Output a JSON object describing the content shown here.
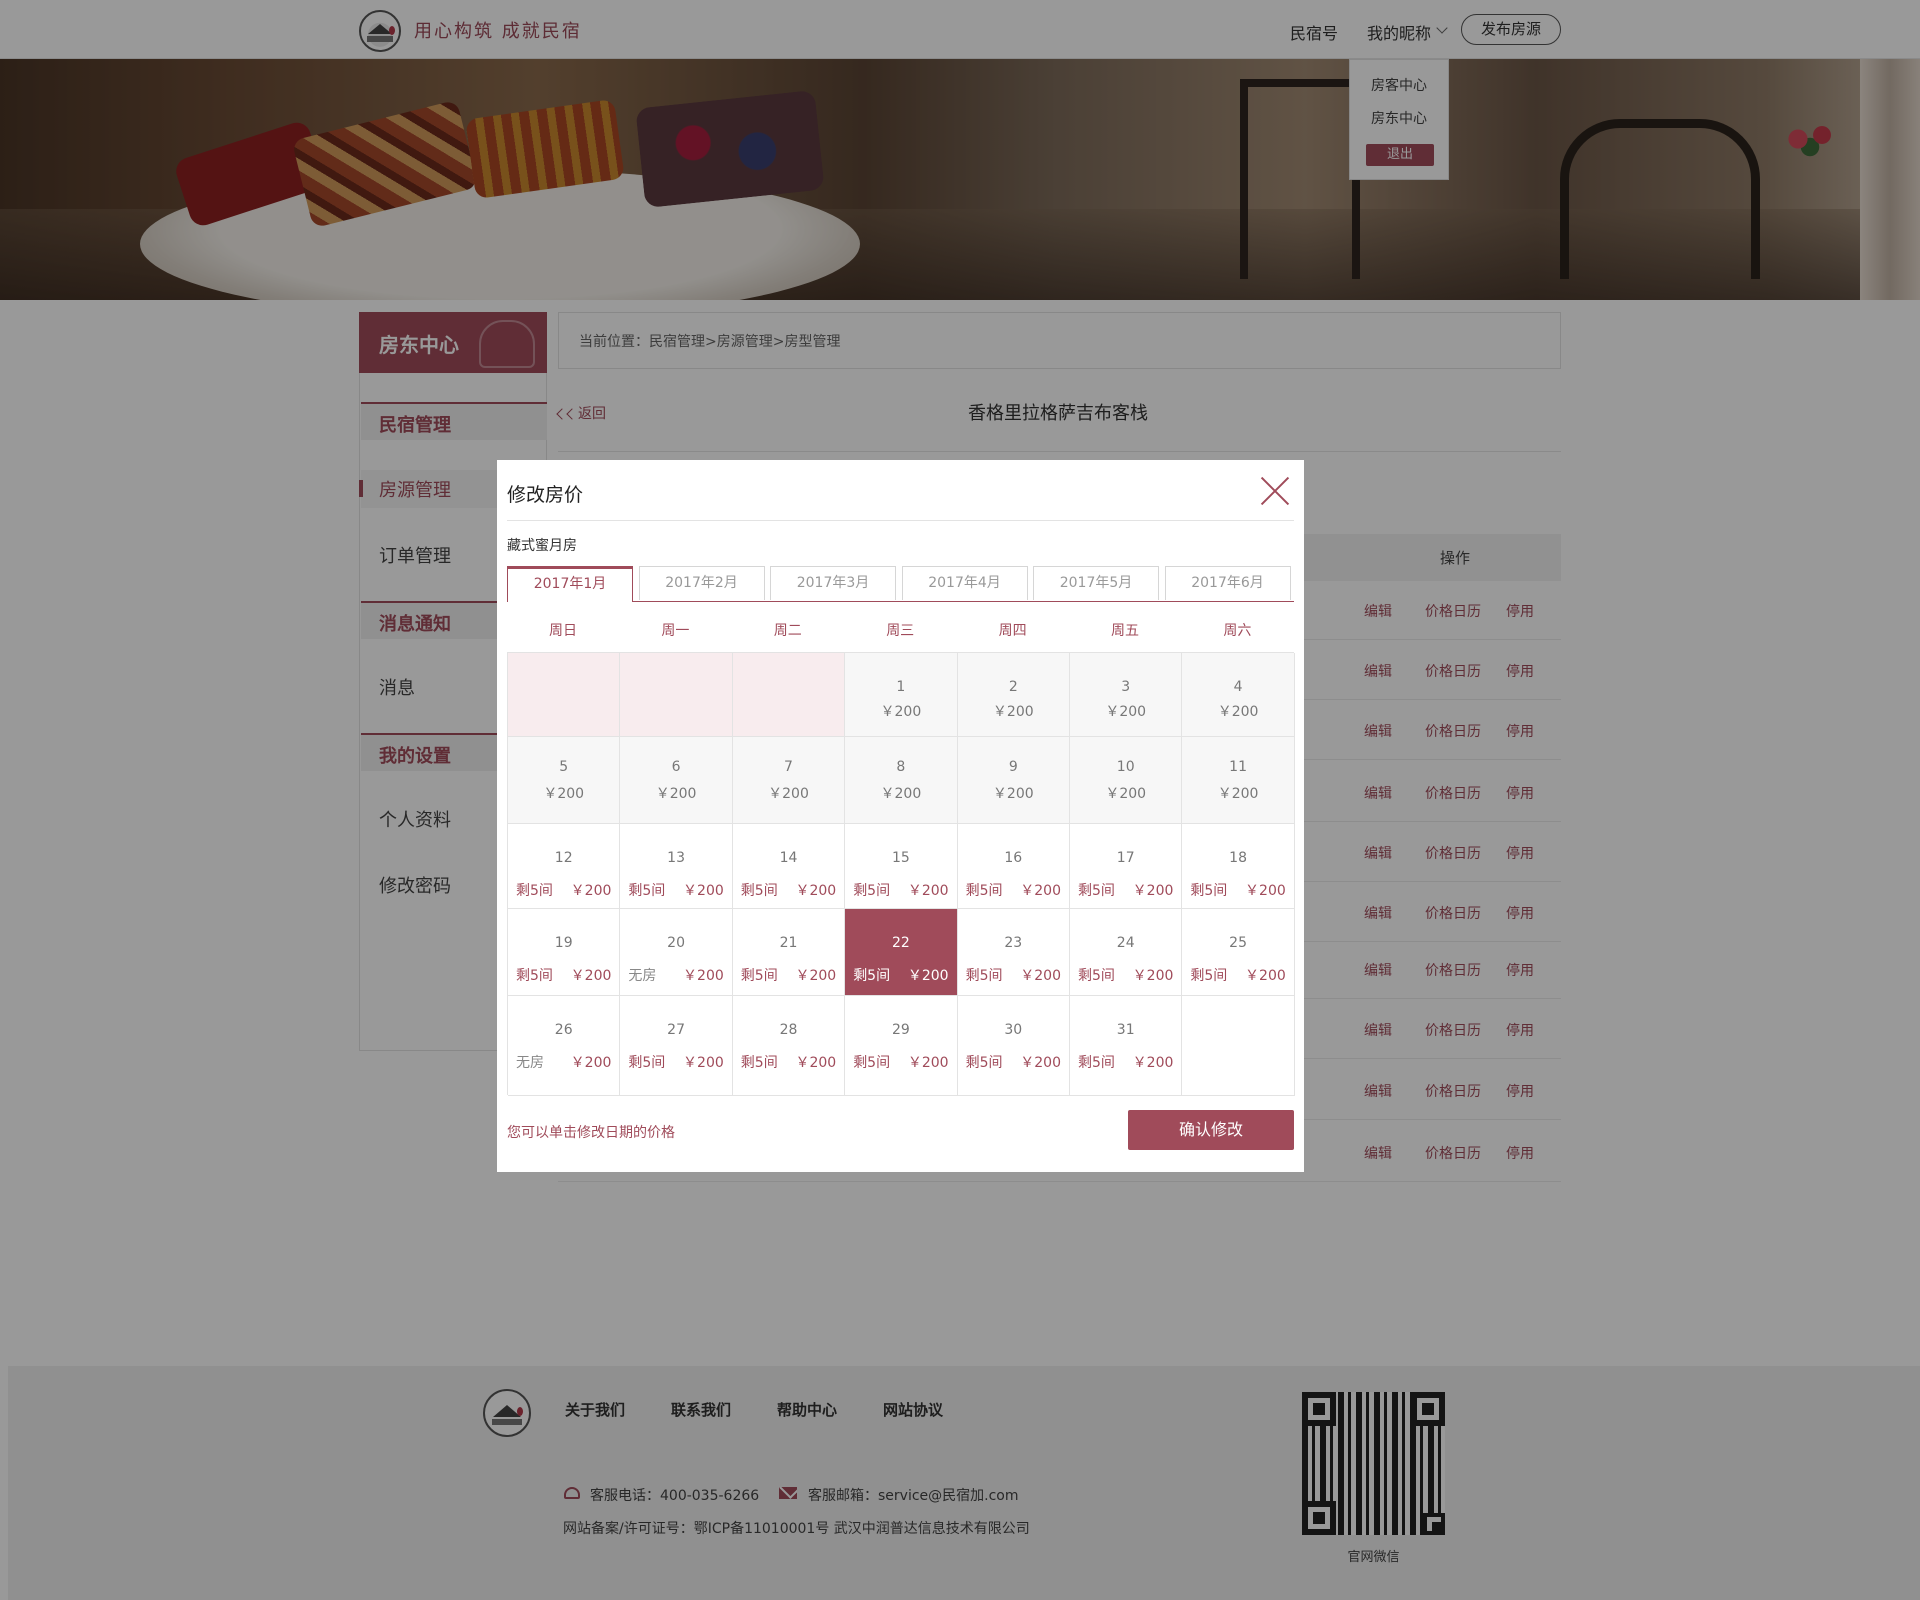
{
  "header": {
    "slogan": "用心构筑  成就民宿",
    "nav_inn": "民宿号",
    "nav_user": "我的昵称",
    "publish_label": "发布房源",
    "dropdown": {
      "guest_center": "房客中心",
      "host_center": "房东中心",
      "logout": "退出"
    }
  },
  "sidebar": {
    "title": "房东中心",
    "sections": [
      {
        "label": "民宿管理",
        "items": [
          "房源管理",
          "订单管理"
        ]
      },
      {
        "label": "消息通知",
        "items": [
          "消息"
        ]
      },
      {
        "label": "我的设置",
        "items": [
          "个人资料",
          "修改密码"
        ]
      }
    ],
    "active_item": "房源管理"
  },
  "main": {
    "breadcrumb": "当前位置：民宿管理>房源管理>房型管理",
    "back_label": "返回",
    "inn_title": "香格里拉格萨吉布客栈",
    "column_ops": "操作",
    "row_actions": {
      "edit": "编辑",
      "calendar": "价格日历",
      "disable": "停用"
    },
    "row_count": 10
  },
  "modal": {
    "title": "修改房价",
    "room_name": "藏式蜜月房",
    "tabs": [
      "2017年1月",
      "2017年2月",
      "2017年3月",
      "2017年4月",
      "2017年5月",
      "2017年6月"
    ],
    "active_tab": 0,
    "weekdays": [
      "周日",
      "周一",
      "周二",
      "周三",
      "周四",
      "周五",
      "周六"
    ],
    "rows": [
      [
        {
          "empty": true
        },
        {
          "empty": true
        },
        {
          "empty": true
        },
        {
          "day": "1",
          "price": "￥200",
          "past": true
        },
        {
          "day": "2",
          "price": "￥200",
          "past": true
        },
        {
          "day": "3",
          "price": "￥200",
          "past": true
        },
        {
          "day": "4",
          "price": "￥200",
          "past": true
        }
      ],
      [
        {
          "day": "5",
          "price": "￥200",
          "past": true
        },
        {
          "day": "6",
          "price": "￥200",
          "past": true
        },
        {
          "day": "7",
          "price": "￥200",
          "past": true
        },
        {
          "day": "8",
          "price": "￥200",
          "past": true
        },
        {
          "day": "9",
          "price": "￥200",
          "past": true
        },
        {
          "day": "10",
          "price": "￥200",
          "past": true
        },
        {
          "day": "11",
          "price": "￥200",
          "past": true
        }
      ],
      [
        {
          "day": "12",
          "rooms": "剩5间",
          "price": "￥200"
        },
        {
          "day": "13",
          "rooms": "剩5间",
          "price": "￥200"
        },
        {
          "day": "14",
          "rooms": "剩5间",
          "price": "￥200"
        },
        {
          "day": "15",
          "rooms": "剩5间",
          "price": "￥200"
        },
        {
          "day": "16",
          "rooms": "剩5间",
          "price": "￥200"
        },
        {
          "day": "17",
          "rooms": "剩5间",
          "price": "￥200"
        },
        {
          "day": "18",
          "rooms": "剩5间",
          "price": "￥200"
        }
      ],
      [
        {
          "day": "19",
          "rooms": "剩5间",
          "price": "￥200"
        },
        {
          "day": "20",
          "rooms": "无房",
          "price": "￥200",
          "soldout": true
        },
        {
          "day": "21",
          "rooms": "剩5间",
          "price": "￥200"
        },
        {
          "day": "22",
          "rooms": "剩5间",
          "price": "￥200",
          "selected": true
        },
        {
          "day": "23",
          "rooms": "剩5间",
          "price": "￥200"
        },
        {
          "day": "24",
          "rooms": "剩5间",
          "price": "￥200"
        },
        {
          "day": "25",
          "rooms": "剩5间",
          "price": "￥200"
        }
      ],
      [
        {
          "day": "26",
          "rooms": "无房",
          "price": "￥200",
          "soldout": true
        },
        {
          "day": "27",
          "rooms": "剩5间",
          "price": "￥200"
        },
        {
          "day": "28",
          "rooms": "剩5间",
          "price": "￥200"
        },
        {
          "day": "29",
          "rooms": "剩5间",
          "price": "￥200"
        },
        {
          "day": "30",
          "rooms": "剩5间",
          "price": "￥200"
        },
        {
          "day": "31",
          "rooms": "剩5间",
          "price": "￥200"
        },
        {
          "empty": true,
          "blank": true
        }
      ]
    ],
    "hint": "您可以单击修改日期的价格",
    "confirm_label": "确认修改"
  },
  "footer": {
    "links": [
      "关于我们",
      "联系我们",
      "帮助中心",
      "网站协议"
    ],
    "phone": "客服电话：400-035-6266",
    "email": "客服邮箱：service@民宿加.com",
    "license": "网站备案/许可证号：鄂ICP备11010001号  武汉中润普达信息技术有限公司",
    "qr_label": "官网微信"
  },
  "colors": {
    "accent": "#a04b5a",
    "overlay": "rgba(0,0,0,0.4)"
  }
}
